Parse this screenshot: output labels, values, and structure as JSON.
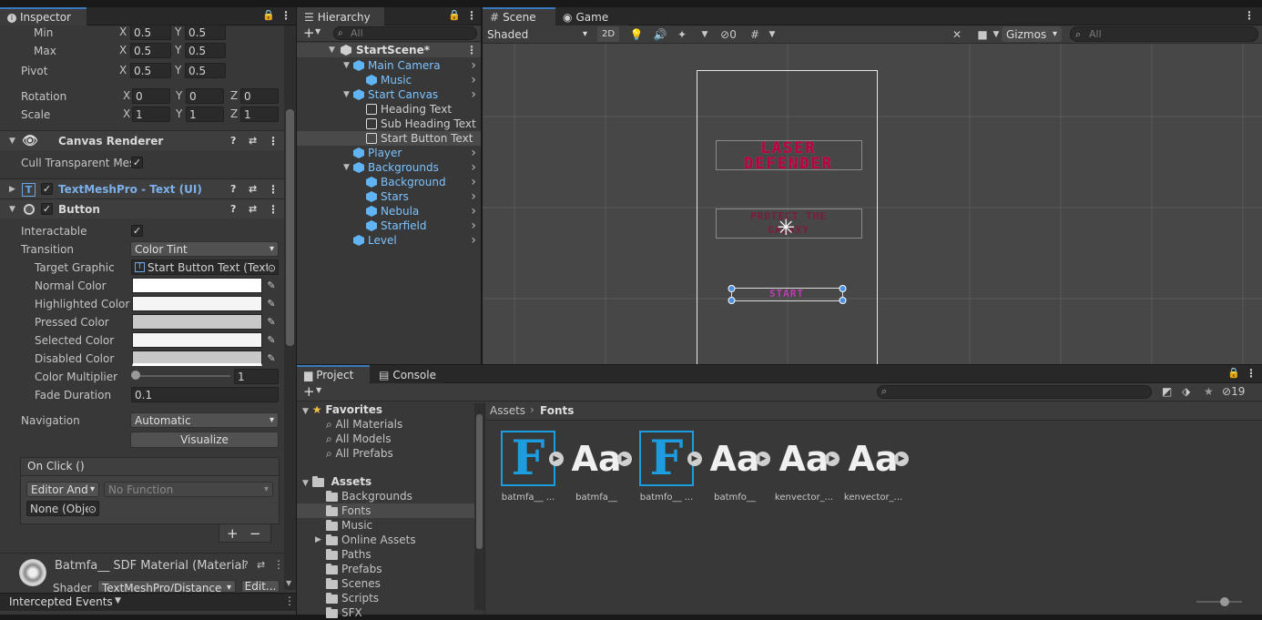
{
  "inspector": {
    "tab": "Inspector",
    "anchors": {
      "min_label": "Min",
      "min_x": "0.5",
      "min_y": "0.5",
      "max_label": "Max",
      "max_x": "0.5",
      "max_y": "0.5",
      "pivot_label": "Pivot",
      "pivot_x": "0.5",
      "pivot_y": "0.5",
      "rotation_label": "Rotation",
      "rot_x": "0",
      "rot_y": "0",
      "rot_z": "0",
      "scale_label": "Scale",
      "scale_x": "1",
      "scale_y": "1",
      "scale_z": "1"
    },
    "axis": {
      "x": "X",
      "y": "Y",
      "z": "Z"
    },
    "canvas_renderer": {
      "title": "Canvas Renderer",
      "cull_label": "Cull Transparent Mes"
    },
    "textmeshpro": {
      "title": "TextMeshPro - Text (UI)"
    },
    "button": {
      "title": "Button",
      "interactable_label": "Interactable",
      "transition_label": "Transition",
      "transition_value": "Color Tint",
      "target_graphic_label": "Target Graphic",
      "target_graphic_value": "Start Button Text (Text",
      "normal_color_label": "Normal Color",
      "highlighted_color_label": "Highlighted Color",
      "pressed_color_label": "Pressed Color",
      "selected_color_label": "Selected Color",
      "disabled_color_label": "Disabled Color",
      "color_multiplier_label": "Color Multiplier",
      "color_multiplier_value": "1",
      "fade_duration_label": "Fade Duration",
      "fade_duration_value": "0.1",
      "navigation_label": "Navigation",
      "navigation_value": "Automatic",
      "visualize_label": "Visualize",
      "onclick_label": "On Click ()",
      "runtime_value": "Editor And",
      "function_value": "No Function",
      "object_value": "None (Obje",
      "plus": "+",
      "minus": "−"
    },
    "material": {
      "title": "Batmfa__ SDF Material (Material",
      "shader_label": "Shader",
      "shader_value": "TextMeshPro/Distance",
      "edit_label": "Edit..."
    },
    "footer": "Intercepted Events"
  },
  "hierarchy": {
    "tab": "Hierarchy",
    "search_placeholder": "All",
    "scene": "StartScene*",
    "items": [
      {
        "label": "Main Camera"
      },
      {
        "label": "Music"
      },
      {
        "label": "Start Canvas"
      },
      {
        "label": "Heading Text"
      },
      {
        "label": "Sub Heading Text"
      },
      {
        "label": "Start Button Text"
      },
      {
        "label": "Player"
      },
      {
        "label": "Backgrounds"
      },
      {
        "label": "Background"
      },
      {
        "label": "Stars"
      },
      {
        "label": "Nebula"
      },
      {
        "label": "Starfield"
      },
      {
        "label": "Level"
      }
    ]
  },
  "scene": {
    "tab_scene": "Scene",
    "tab_game": "Game",
    "shading": "Shaded",
    "mode_2d": "2D",
    "hidden_count": "0",
    "gizmos": "Gizmos",
    "search_placeholder": "All",
    "heading_line1": "LASER",
    "heading_line2": "DEFENDER",
    "sub_line1": "PROTECT THE",
    "sub_line2": "GALAXY",
    "start_label": "START"
  },
  "project": {
    "tab_project": "Project",
    "tab_console": "Console",
    "hidden_count": "19",
    "favorites_label": "Favorites",
    "favorites": [
      "All Materials",
      "All Models",
      "All Prefabs"
    ],
    "assets_label": "Assets",
    "folders": [
      "Backgrounds",
      "Fonts",
      "Music",
      "Online Assets",
      "Paths",
      "Prefabs",
      "Scenes",
      "Scripts",
      "SFX"
    ],
    "breadcrumb_root": "Assets",
    "breadcrumb_current": "Fonts",
    "asset_items": [
      {
        "glyph": "F",
        "label": "batmfa__ ..."
      },
      {
        "glyph": "Aa",
        "label": "batmfa__"
      },
      {
        "glyph": "F",
        "label": "batmfo__ ..."
      },
      {
        "glyph": "Aa",
        "label": "batmfo__"
      },
      {
        "glyph": "Aa",
        "label": "kenvector_..."
      },
      {
        "glyph": "Aa",
        "label": "kenvector_..."
      }
    ]
  },
  "colors": {
    "accent": "#3a79bb",
    "hierarchy_blue": "#7cc3ff",
    "panel": "#383838"
  }
}
